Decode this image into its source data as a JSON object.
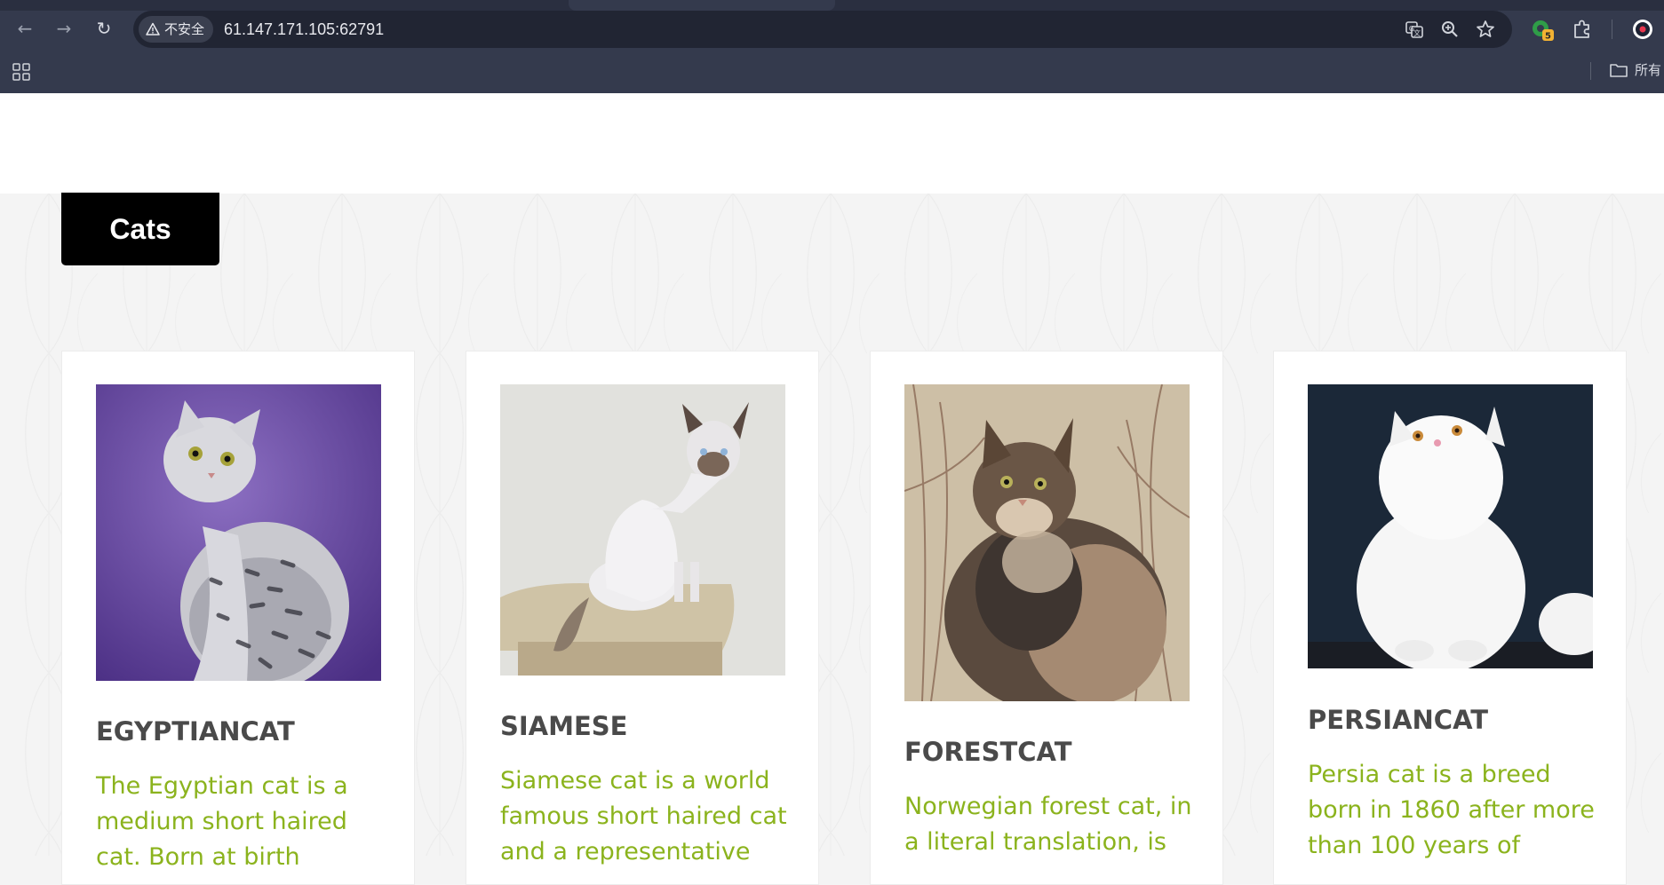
{
  "browser": {
    "back_label": "←",
    "forward_label": "→",
    "reload_label": "↻",
    "security_label": "不安全",
    "url": "61.147.171.105:62791",
    "extension_badge": "5",
    "bookmark_folder_label": "所有"
  },
  "page": {
    "header_tab": "Cats",
    "cards": [
      {
        "name": "EGYPTIANCAT",
        "description": "The Egyptian cat is a medium short haired cat. Born at birth"
      },
      {
        "name": "SIAMESE",
        "description": "Siamese cat is a world famous short haired cat and a representative"
      },
      {
        "name": "FORESTCAT",
        "description": "Norwegian forest cat, in a literal translation, is"
      },
      {
        "name": "PERSIANCAT",
        "description": "Persia cat is a breed born in 1860 after more than 100 years of"
      }
    ]
  },
  "colors": {
    "chrome": "#343a4d",
    "omnibox": "#212533",
    "tab_black": "#000000",
    "title_gray": "#4a4a4a",
    "desc_green": "#8bb31d",
    "page_bg": "#f4f4f4"
  }
}
